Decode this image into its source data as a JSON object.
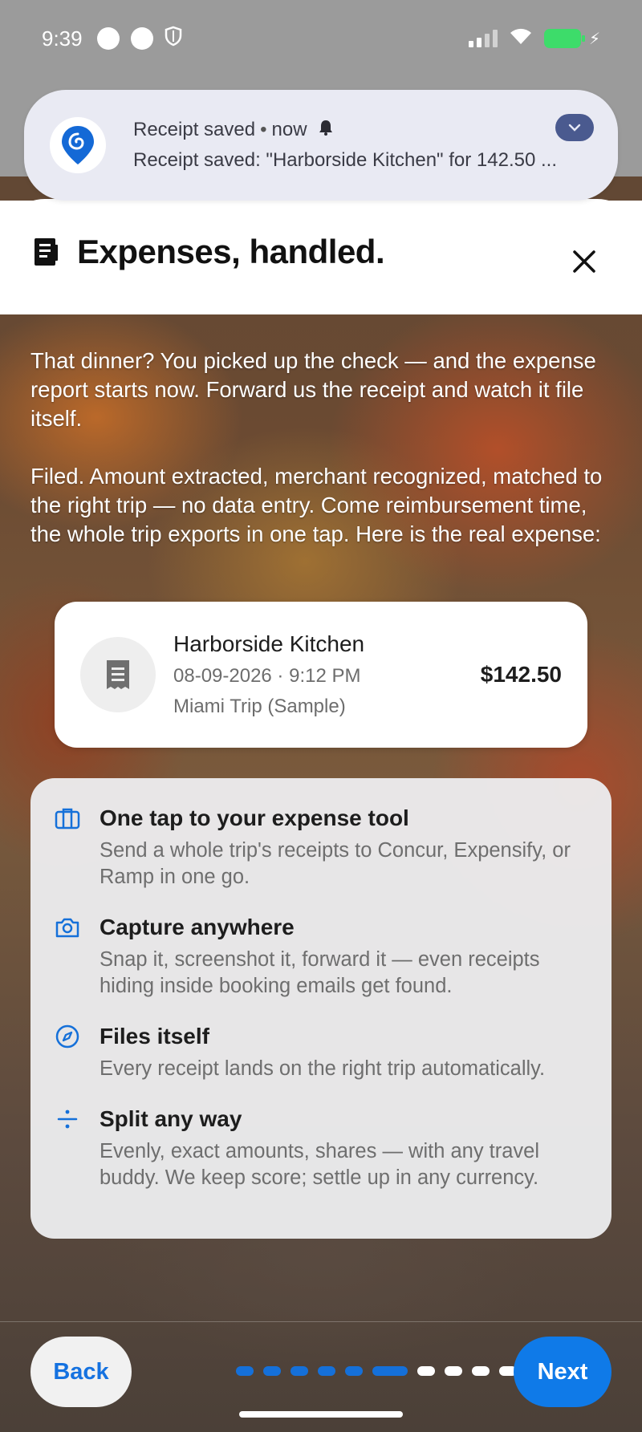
{
  "status_bar": {
    "time": "9:39"
  },
  "notification": {
    "app_title": "Receipt saved",
    "separator": "•",
    "when": "now",
    "message": "Receipt saved: \"Harborside Kitchen\" for 142.50 ..."
  },
  "sheet": {
    "title": "Expenses, handled.",
    "intro_paragraphs": [
      "That dinner? You picked up the check — and the expense report starts now. Forward us the receipt and watch it file itself.",
      "Filed. Amount extracted, merchant recognized, matched to the right trip — no data entry. Come reimbursement time, the whole trip exports in one tap. Here is the real expense:"
    ]
  },
  "expense_card": {
    "merchant": "Harborside Kitchen",
    "date_time": "08-09-2026 · 9:12 PM",
    "trip": "Miami Trip (Sample)",
    "amount": "$142.50"
  },
  "features": [
    {
      "icon": "briefcase-icon",
      "title": "One tap to your expense tool",
      "desc": "Send a whole trip's receipts to Concur, Expensify, or Ramp in one go."
    },
    {
      "icon": "camera-icon",
      "title": "Capture anywhere",
      "desc": "Snap it, screenshot it, forward it — even receipts hiding inside booking emails get found."
    },
    {
      "icon": "compass-icon",
      "title": "Files itself",
      "desc": "Every receipt lands on the right trip automatically."
    },
    {
      "icon": "divide-icon",
      "title": "Split any way",
      "desc": "Evenly, exact amounts, shares — with any travel buddy. We keep score; settle up in any currency."
    }
  ],
  "nav": {
    "back_label": "Back",
    "next_label": "Next",
    "pager_total": 10,
    "pager_current": 6
  },
  "colors": {
    "accent": "#0f7ae8",
    "pager_done": "#1570d9",
    "notification_bg": "#e9eaf3"
  }
}
